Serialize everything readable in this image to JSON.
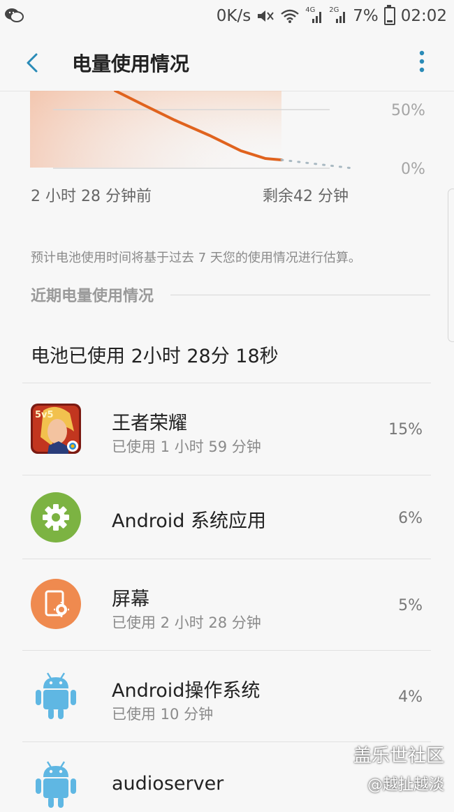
{
  "status_bar": {
    "net_speed": "0K/s",
    "net_4g": "4G",
    "net_2g": "2G",
    "battery_pct": "7%",
    "time": "02:02",
    "icons": [
      "wechat-icon",
      "mute-icon",
      "wifi-icon",
      "signal-4g-icon",
      "signal-2g-icon",
      "battery-icon"
    ]
  },
  "app_bar": {
    "title": "电量使用情况",
    "back_icon": "back-arrow-icon",
    "more_icon": "more-vert-icon"
  },
  "chart_data": {
    "type": "line",
    "y_ticks": [
      "50%",
      "0%"
    ],
    "x_labels": [
      "2 小时 28 分钟前",
      "剩余42 分钟"
    ],
    "ylim": [
      0,
      100
    ],
    "series": [
      {
        "style": "solid",
        "color": "#e0631e",
        "points": [
          [
            0,
            100
          ],
          [
            0.2,
            85
          ],
          [
            0.5,
            60
          ],
          [
            0.8,
            35
          ],
          [
            1,
            7
          ]
        ]
      },
      {
        "style": "dotted",
        "color": "#a9b9c2",
        "points": [
          [
            1,
            7
          ],
          [
            1.3,
            0
          ]
        ]
      }
    ]
  },
  "estimate_note": "预计电池使用时间将基于过去 7 天您的使用情况进行估算。",
  "section_title": "近期电量使用情况",
  "summary": "电池已使用 2小时 28分 18秒",
  "apps": [
    {
      "name": "王者荣耀",
      "sub": "已使用 1 小时 59 分钟",
      "pct": "15%",
      "icon": "game-icon"
    },
    {
      "name": "Android 系统应用",
      "sub": "",
      "pct": "6%",
      "icon": "settings-gear-icon"
    },
    {
      "name": "屏幕",
      "sub": "已使用 2 小时 28 分钟",
      "pct": "5%",
      "icon": "screen-brightness-icon"
    },
    {
      "name": "Android操作系统",
      "sub": "已使用 10 分钟",
      "pct": "4%",
      "icon": "android-icon"
    },
    {
      "name": "audioserver",
      "sub": "",
      "pct": "",
      "icon": "android-icon"
    }
  ],
  "watermark": {
    "line1": "盖乐世社区",
    "line2": "@越扯越淡"
  },
  "colors": {
    "accent": "#2a8bb7",
    "chart_line": "#e0631e",
    "gear_bg": "#7cb342",
    "screen_bg": "#ef8a4f",
    "android_green": "#5fb7e3"
  }
}
